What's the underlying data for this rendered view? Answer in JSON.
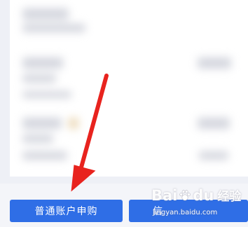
{
  "buttons": {
    "normal_account_label": "普通账户申购",
    "second_label_partial": "信"
  },
  "watermark": {
    "brand_prefix": "Bai",
    "brand_suffix": "du",
    "product": "经验",
    "url": "jingyan.baidu.com"
  },
  "annotation": {
    "arrow_color": "#e8231e",
    "points_to": "normal_account_button"
  },
  "colors": {
    "button_bg": "#2f6ee6",
    "button_text": "#ffffff",
    "page_bg": "#eef0f6"
  }
}
